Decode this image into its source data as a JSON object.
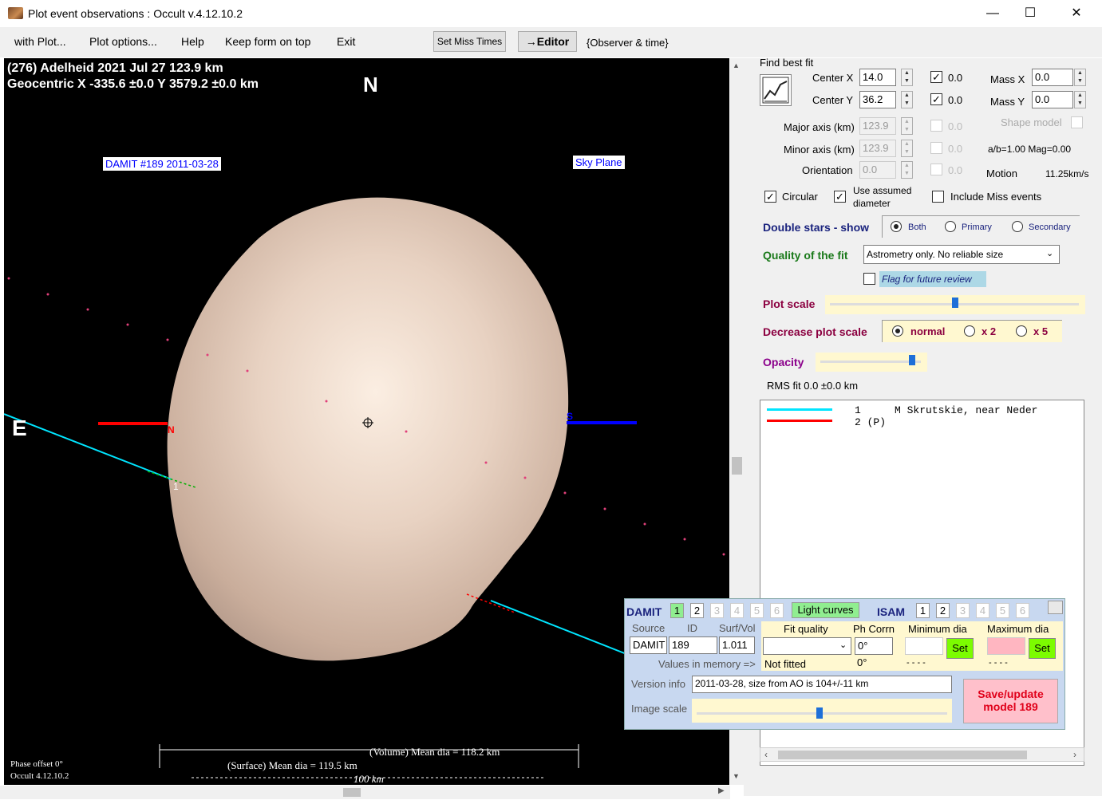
{
  "window": {
    "title": "Plot event observations : Occult v.4.12.10.2",
    "min": "—",
    "max": "☐",
    "close": "✕"
  },
  "menu": {
    "items": [
      "with Plot...",
      "Plot options...",
      "Help",
      "Keep form on top",
      "Exit"
    ],
    "set_miss_times": "Set Miss Times",
    "editor": "→Editor",
    "observer_time": "{Observer & time}"
  },
  "plot": {
    "header1": "(276) Adelheid  2021 Jul 27   123.9 km",
    "header2": "Geocentric  X  -335.6 ±0.0  Y 3579.2 ±0.0 km",
    "north": "N",
    "east": "E",
    "damit_label": "DAMIT #189 2011-03-28",
    "sky_plane": "Sky Plane",
    "chord_n": "N",
    "chord_s": "S",
    "chord1_label": "1",
    "chord2_label": "1",
    "volume_dia": "(Volume) Mean dia = 118.2 km",
    "surface_dia": "(Surface) Mean dia = 119.5 km",
    "scale": "100 km",
    "phase_offset": "Phase offset 0°",
    "version": "Occult 4.12.10.2"
  },
  "fit": {
    "find_best_fit": "Find best fit",
    "center_x_label": "Center X",
    "center_x": "14.0",
    "center_x_chk": "0.0",
    "center_y_label": "Center Y",
    "center_y": "36.2",
    "center_y_chk": "0.0",
    "mass_x_label": "Mass X",
    "mass_x": "0.0",
    "mass_y_label": "Mass Y",
    "mass_y": "0.0",
    "major_label": "Major axis (km)",
    "major": "123.9",
    "major_chk": "0.0",
    "minor_label": "Minor axis (km)",
    "minor": "123.9",
    "minor_chk": "0.0",
    "orient_label": "Orientation",
    "orient": "0.0",
    "orient_chk": "0.0",
    "shape_model": "Shape model",
    "ab_mag": "a/b=1.00 Mag=0.00",
    "motion_label": "Motion",
    "motion": "11.25km/s",
    "circular": "Circular",
    "use_assumed": "Use assumed",
    "diameter": "diameter",
    "include_miss": "Include Miss events"
  },
  "double_stars": {
    "label": "Double stars - show",
    "options": [
      "Both",
      "Primary",
      "Secondary"
    ],
    "selected": "Both"
  },
  "quality": {
    "label": "Quality of the fit",
    "value": "Astrometry only. No reliable size",
    "flag": "Flag for future review"
  },
  "plot_scale": {
    "label": "Plot scale",
    "level": 0.5
  },
  "decrease_scale": {
    "label": "Decrease plot scale",
    "options": [
      "normal",
      "x 2",
      "x 5"
    ],
    "selected": "normal"
  },
  "opacity": {
    "label": "Opacity",
    "level": 0.9
  },
  "rms": "RMS fit 0.0 ±0.0 km",
  "observers": [
    {
      "num": "1",
      "name": "M Skrutskie, near Neder",
      "color": "#00e5ff"
    },
    {
      "num": "2 (P)",
      "name": "",
      "color": "#ff0000"
    }
  ],
  "damit_panel": {
    "damit": "DAMIT",
    "tabs": [
      "1",
      "2",
      "3",
      "4",
      "5",
      "6"
    ],
    "light_curves": "Light curves",
    "isam": "ISAM",
    "isam_tabs": [
      "1",
      "2",
      "3",
      "4",
      "5",
      "6"
    ],
    "source_h": "Source",
    "id_h": "ID",
    "surf_h": "Surf/Vol",
    "source": "DAMIT",
    "id": "189",
    "surf": "1.011",
    "values_in_memory": "Values in memory =>",
    "fit_quality_h": "Fit quality",
    "ph_corr_h": "Ph Corrn",
    "min_dia_h": "Minimum dia",
    "max_dia_h": "Maximum dia",
    "ph_corr": "0°",
    "not_fitted": "Not fitted",
    "ph_mem": "0°",
    "min_dash": "- - - -",
    "max_dash": "- - - -",
    "set": "Set",
    "version_label": "Version info",
    "version_value": "2011-03-28, size from AO is 104+/-11 km",
    "image_scale": "Image scale",
    "image_scale_level": 0.49,
    "save_line1": "Save/update",
    "save_line2": "model 189"
  }
}
